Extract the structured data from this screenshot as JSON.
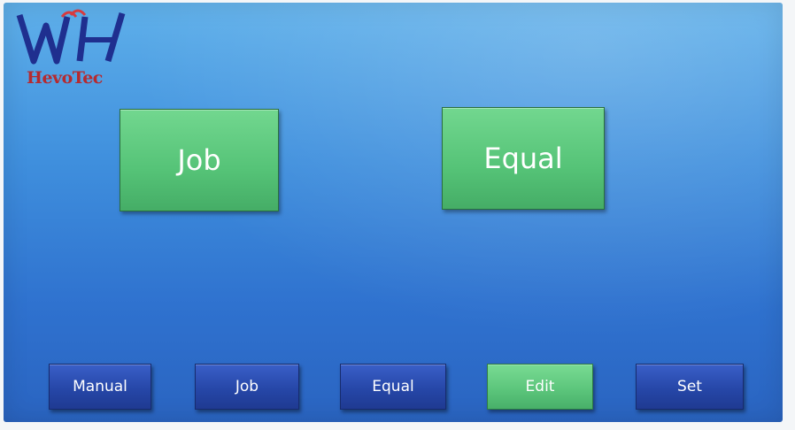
{
  "brand": {
    "name": "HevoTec",
    "logo_icon": "hevotec-hvh-logo",
    "logo_color": "#1f2f8f",
    "accent_color": "#d73a3f"
  },
  "main": {
    "buttons": [
      {
        "label": "Job"
      },
      {
        "label": "Equal"
      }
    ]
  },
  "nav": {
    "active": "Edit",
    "items": [
      {
        "label": "Manual"
      },
      {
        "label": "Job"
      },
      {
        "label": "Equal"
      },
      {
        "label": "Edit"
      },
      {
        "label": "Set"
      }
    ]
  },
  "colors": {
    "background": "#3f8fdd",
    "primary_button": "#55c377",
    "nav_button": "#2647a8"
  }
}
